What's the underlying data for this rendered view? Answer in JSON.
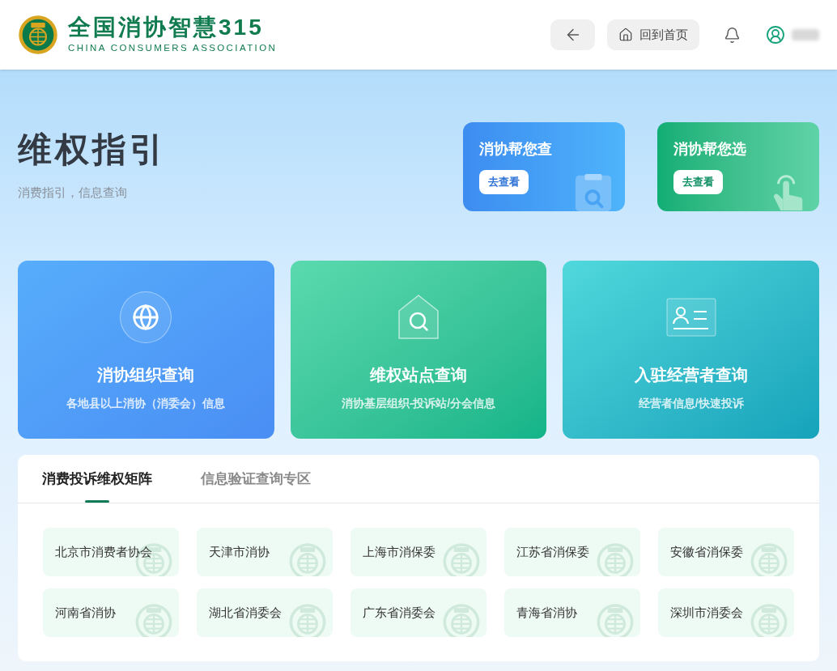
{
  "header": {
    "brand_title": "全国消协智慧315",
    "brand_subtitle": "CHINA CONSUMERS ASSOCIATION",
    "home_button": "回到首页"
  },
  "hero": {
    "title": "维权指引",
    "subtitle": "消费指引，信息查询",
    "promos": [
      {
        "title": "消协帮您查",
        "button": "去查看",
        "kind": "blue"
      },
      {
        "title": "消协帮您选",
        "button": "去查看",
        "kind": "green"
      }
    ]
  },
  "services": [
    {
      "title": "消协组织查询",
      "subtitle": "各地县以上消协（消委会）信息",
      "kind": "blue"
    },
    {
      "title": "维权站点查询",
      "subtitle": "消协基层组织-投诉站/分会信息",
      "kind": "green"
    },
    {
      "title": "入驻经营者查询",
      "subtitle": "经营者信息/快速投诉",
      "kind": "teal"
    }
  ],
  "tabs": [
    {
      "label": "消费投诉维权矩阵",
      "selected": true
    },
    {
      "label": "信息验证查询专区",
      "selected": false
    }
  ],
  "organizations": [
    "北京市消费者协会",
    "天津市消协",
    "上海市消保委",
    "江苏省消保委",
    "安徽省消保委",
    "河南省消协",
    "湖北省消委会",
    "广东省消委会",
    "青海省消协",
    "深圳市消委会"
  ]
}
